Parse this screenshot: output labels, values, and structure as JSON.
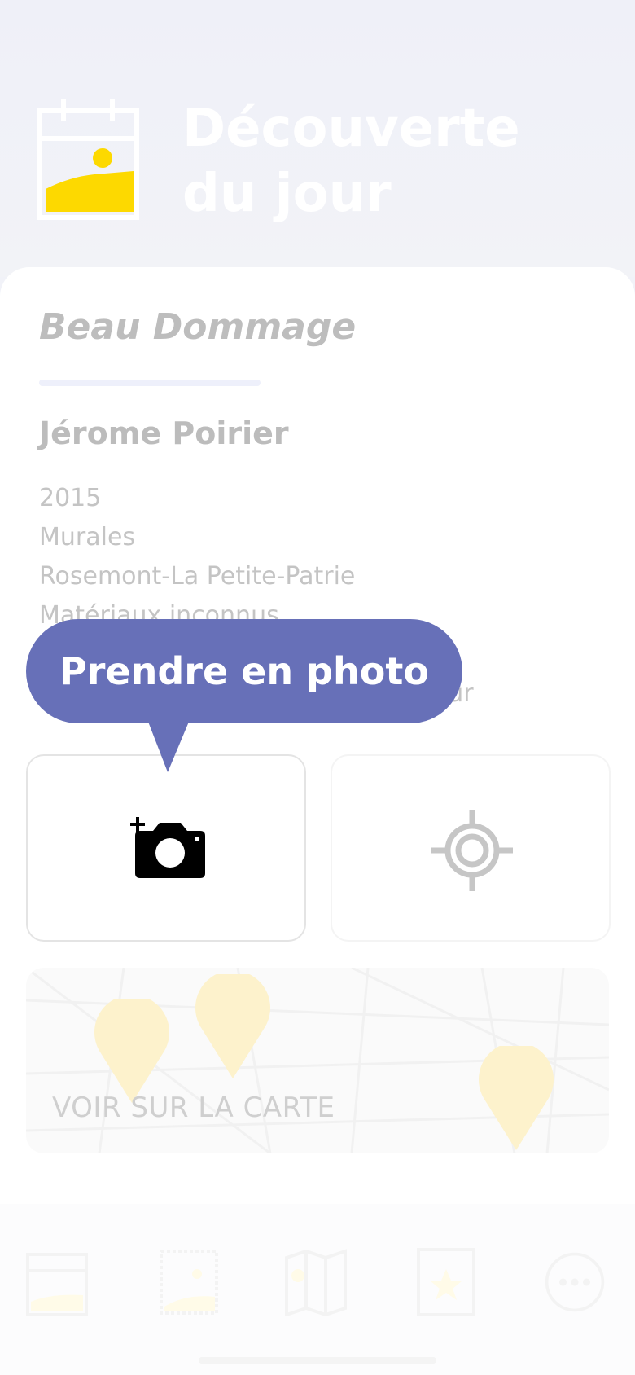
{
  "header": {
    "title_line1": "Découverte",
    "title_line2": "du jour",
    "icon": "calendar-image-icon"
  },
  "artwork": {
    "title": "Beau Dommage",
    "artist": "Jérome Poirier",
    "details": [
      "2015",
      "Murales",
      "Rosemont-La Petite-Patrie",
      "Matériaux inconnus"
    ],
    "partial_text": "teur"
  },
  "actions": {
    "photo_tooltip": "Prendre en photo",
    "camera_icon": "camera-add-icon",
    "locate_icon": "target-icon"
  },
  "map": {
    "label": "VOIR SUR LA CARTE"
  },
  "tabbar": {
    "items": [
      "calendar-icon",
      "gallery-icon",
      "map-icon",
      "favorites-icon",
      "more-icon"
    ]
  },
  "colors": {
    "accent": "#6770b8",
    "yellow": "#fdd900"
  }
}
